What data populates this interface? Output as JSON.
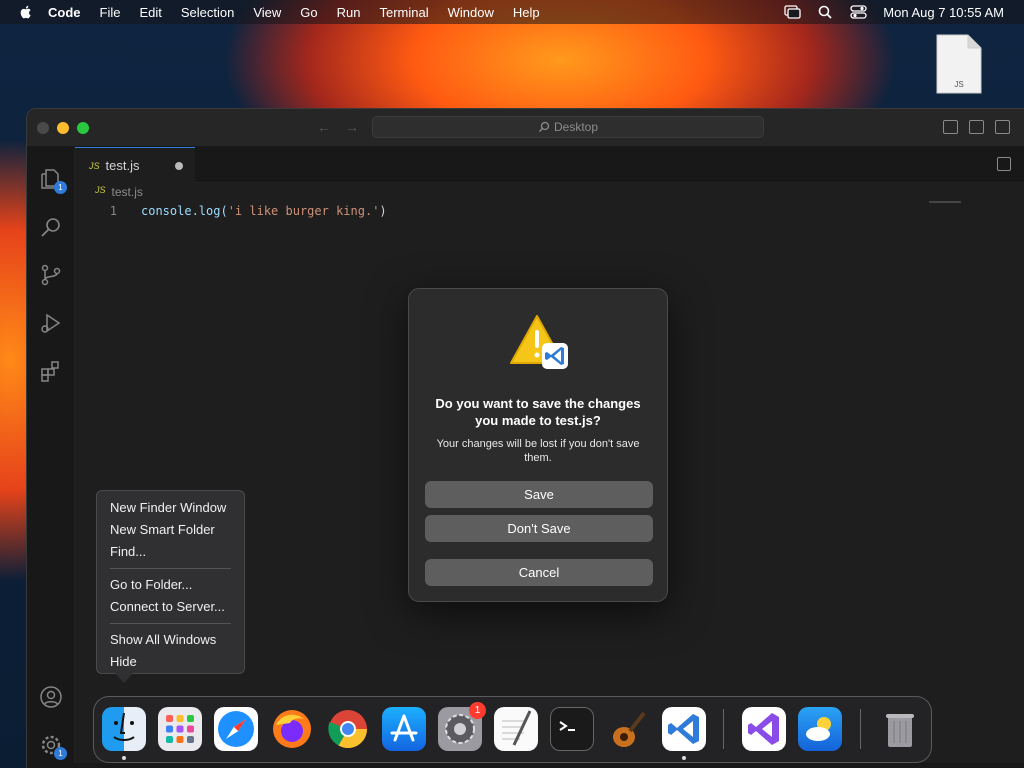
{
  "menubar": {
    "app_name": "Code",
    "items": [
      "File",
      "Edit",
      "Selection",
      "View",
      "Go",
      "Run",
      "Terminal",
      "Window",
      "Help"
    ],
    "datetime": "Mon Aug 7  10:55 AM"
  },
  "desktop": {
    "file_icon_label": "JS"
  },
  "vscode": {
    "search_placeholder": "Desktop",
    "tab": {
      "file_type": "JS",
      "file_name": "test.js"
    },
    "breadcrumb": {
      "file_type": "JS",
      "file_name": "test.js"
    },
    "editor": {
      "line_number": "1",
      "code": {
        "fn": "console.log(",
        "str": "'i like burger king.'",
        "close": ")"
      }
    },
    "explorer_badge": "1",
    "settings_badge": "1"
  },
  "dialog": {
    "title": "Do you want to save the changes you made to test.js?",
    "message": "Your changes will be lost if you don't save them.",
    "save_label": "Save",
    "dont_save_label": "Don't Save",
    "cancel_label": "Cancel"
  },
  "dock_menu": {
    "items": [
      "New Finder Window",
      "New Smart Folder",
      "Find...",
      "Go to Folder...",
      "Connect to Server...",
      "Show All Windows",
      "Hide"
    ]
  },
  "dock": {
    "apps": [
      "finder",
      "launchpad",
      "safari",
      "firefox",
      "chrome",
      "app-store",
      "system-settings",
      "textedit",
      "terminal",
      "garageband",
      "vscode",
      "visual-studio",
      "weather",
      "trash"
    ],
    "settings_badge": "1"
  },
  "colors": {
    "accent": "#2f7bd9",
    "dialog_bg": "#2c2c2c",
    "button_bg": "#5e5e5e",
    "warning_yellow": "#f5c518"
  }
}
